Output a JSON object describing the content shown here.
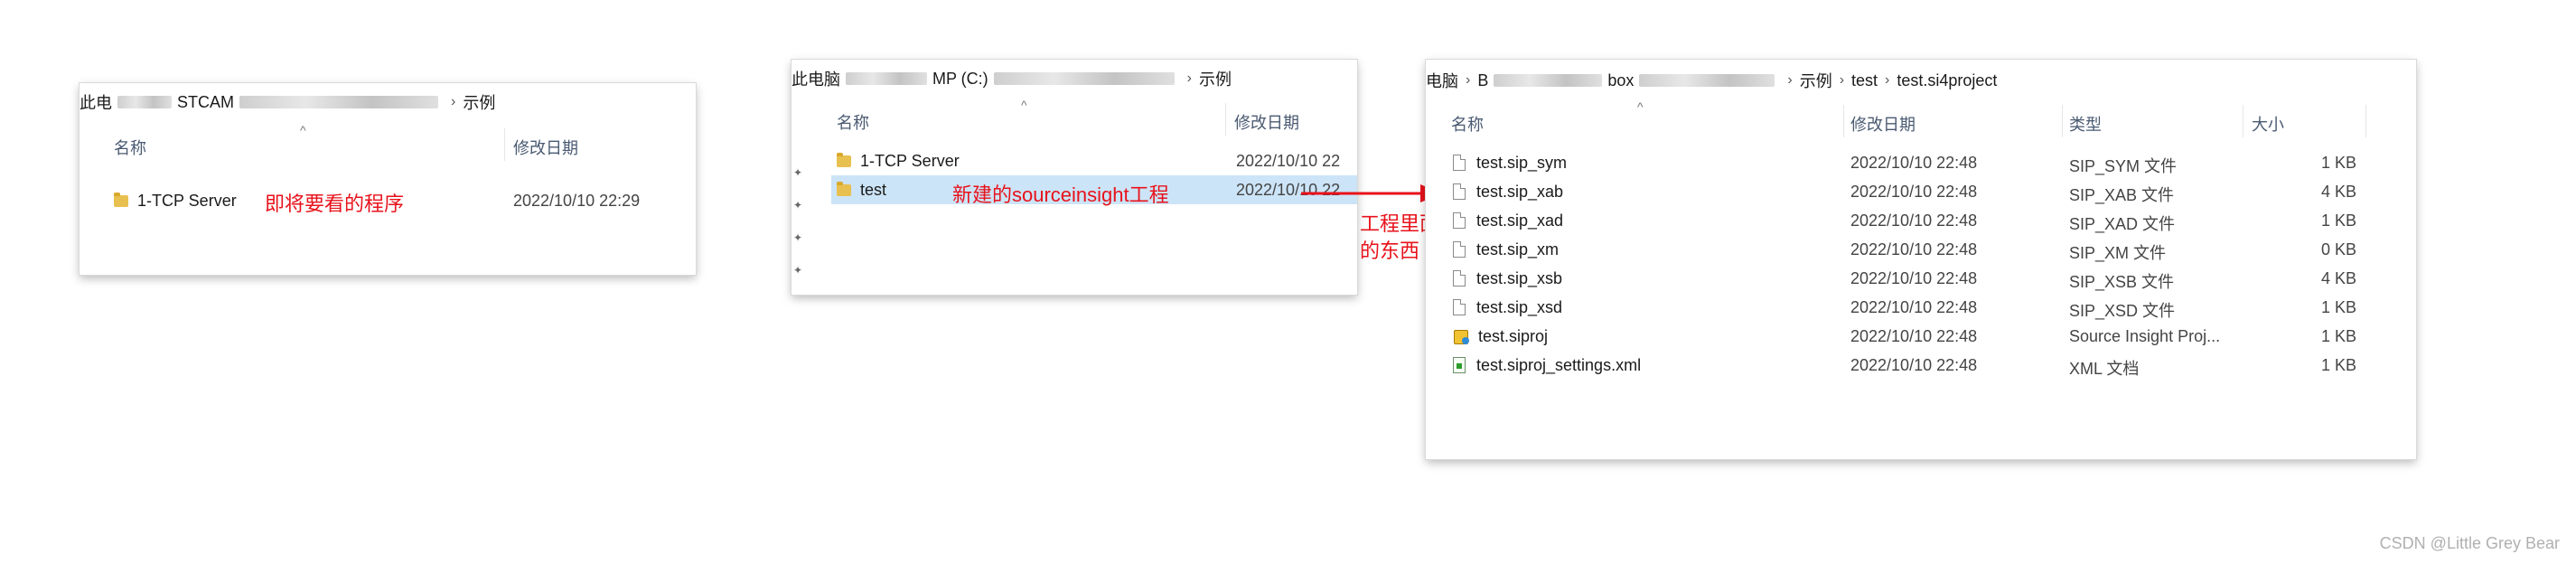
{
  "window1": {
    "breadcrumb_prefix": "此电",
    "breadcrumb_mid": "STCAM",
    "breadcrumb_last": "示例",
    "col_name": "名称",
    "col_date": "修改日期",
    "rows": [
      {
        "name": "1-TCP Server",
        "date": "2022/10/10 22:29"
      }
    ],
    "annotation": "即将要看的程序"
  },
  "window2": {
    "breadcrumb_prefix": "此电脑",
    "breadcrumb_mid": "MP (C:)",
    "breadcrumb_last": "示例",
    "col_name": "名称",
    "col_date": "修改日期",
    "rows": [
      {
        "name": "1-TCP Server",
        "date": "2022/10/10 22"
      },
      {
        "name": "test",
        "date": "2022/10/10 22"
      }
    ],
    "annotation": "新建的sourceinsight工程"
  },
  "window3": {
    "breadcrumb": [
      "电脑",
      "B",
      "box",
      "示例",
      "test",
      "test.si4project"
    ],
    "col_name": "名称",
    "col_date": "修改日期",
    "col_type": "类型",
    "col_size": "大小",
    "rows": [
      {
        "name": "test.sip_sym",
        "date": "2022/10/10 22:48",
        "type": "SIP_SYM 文件",
        "size": "1 KB",
        "icon": "file-icon"
      },
      {
        "name": "test.sip_xab",
        "date": "2022/10/10 22:48",
        "type": "SIP_XAB 文件",
        "size": "4 KB",
        "icon": "file-icon"
      },
      {
        "name": "test.sip_xad",
        "date": "2022/10/10 22:48",
        "type": "SIP_XAD 文件",
        "size": "1 KB",
        "icon": "file-icon"
      },
      {
        "name": "test.sip_xm",
        "date": "2022/10/10 22:48",
        "type": "SIP_XM 文件",
        "size": "0 KB",
        "icon": "file-icon"
      },
      {
        "name": "test.sip_xsb",
        "date": "2022/10/10 22:48",
        "type": "SIP_XSB 文件",
        "size": "4 KB",
        "icon": "file-icon"
      },
      {
        "name": "test.sip_xsd",
        "date": "2022/10/10 22:48",
        "type": "SIP_XSD 文件",
        "size": "1 KB",
        "icon": "file-icon"
      },
      {
        "name": "test.siproj",
        "date": "2022/10/10 22:48",
        "type": "Source Insight Proj...",
        "size": "1 KB",
        "icon": "source-insight-project-icon"
      },
      {
        "name": "test.siproj_settings.xml",
        "date": "2022/10/10 22:48",
        "type": "XML 文档",
        "size": "1 KB",
        "icon": "xml-file-icon"
      }
    ]
  },
  "arrow_annotation_line1": "工程里面",
  "arrow_annotation_line2": "的东西",
  "watermark": "CSDN @Little Grey Bear",
  "colors": {
    "annotation": "#e8121b",
    "selection": "#cce4f7",
    "folder": "#e8c04f"
  }
}
